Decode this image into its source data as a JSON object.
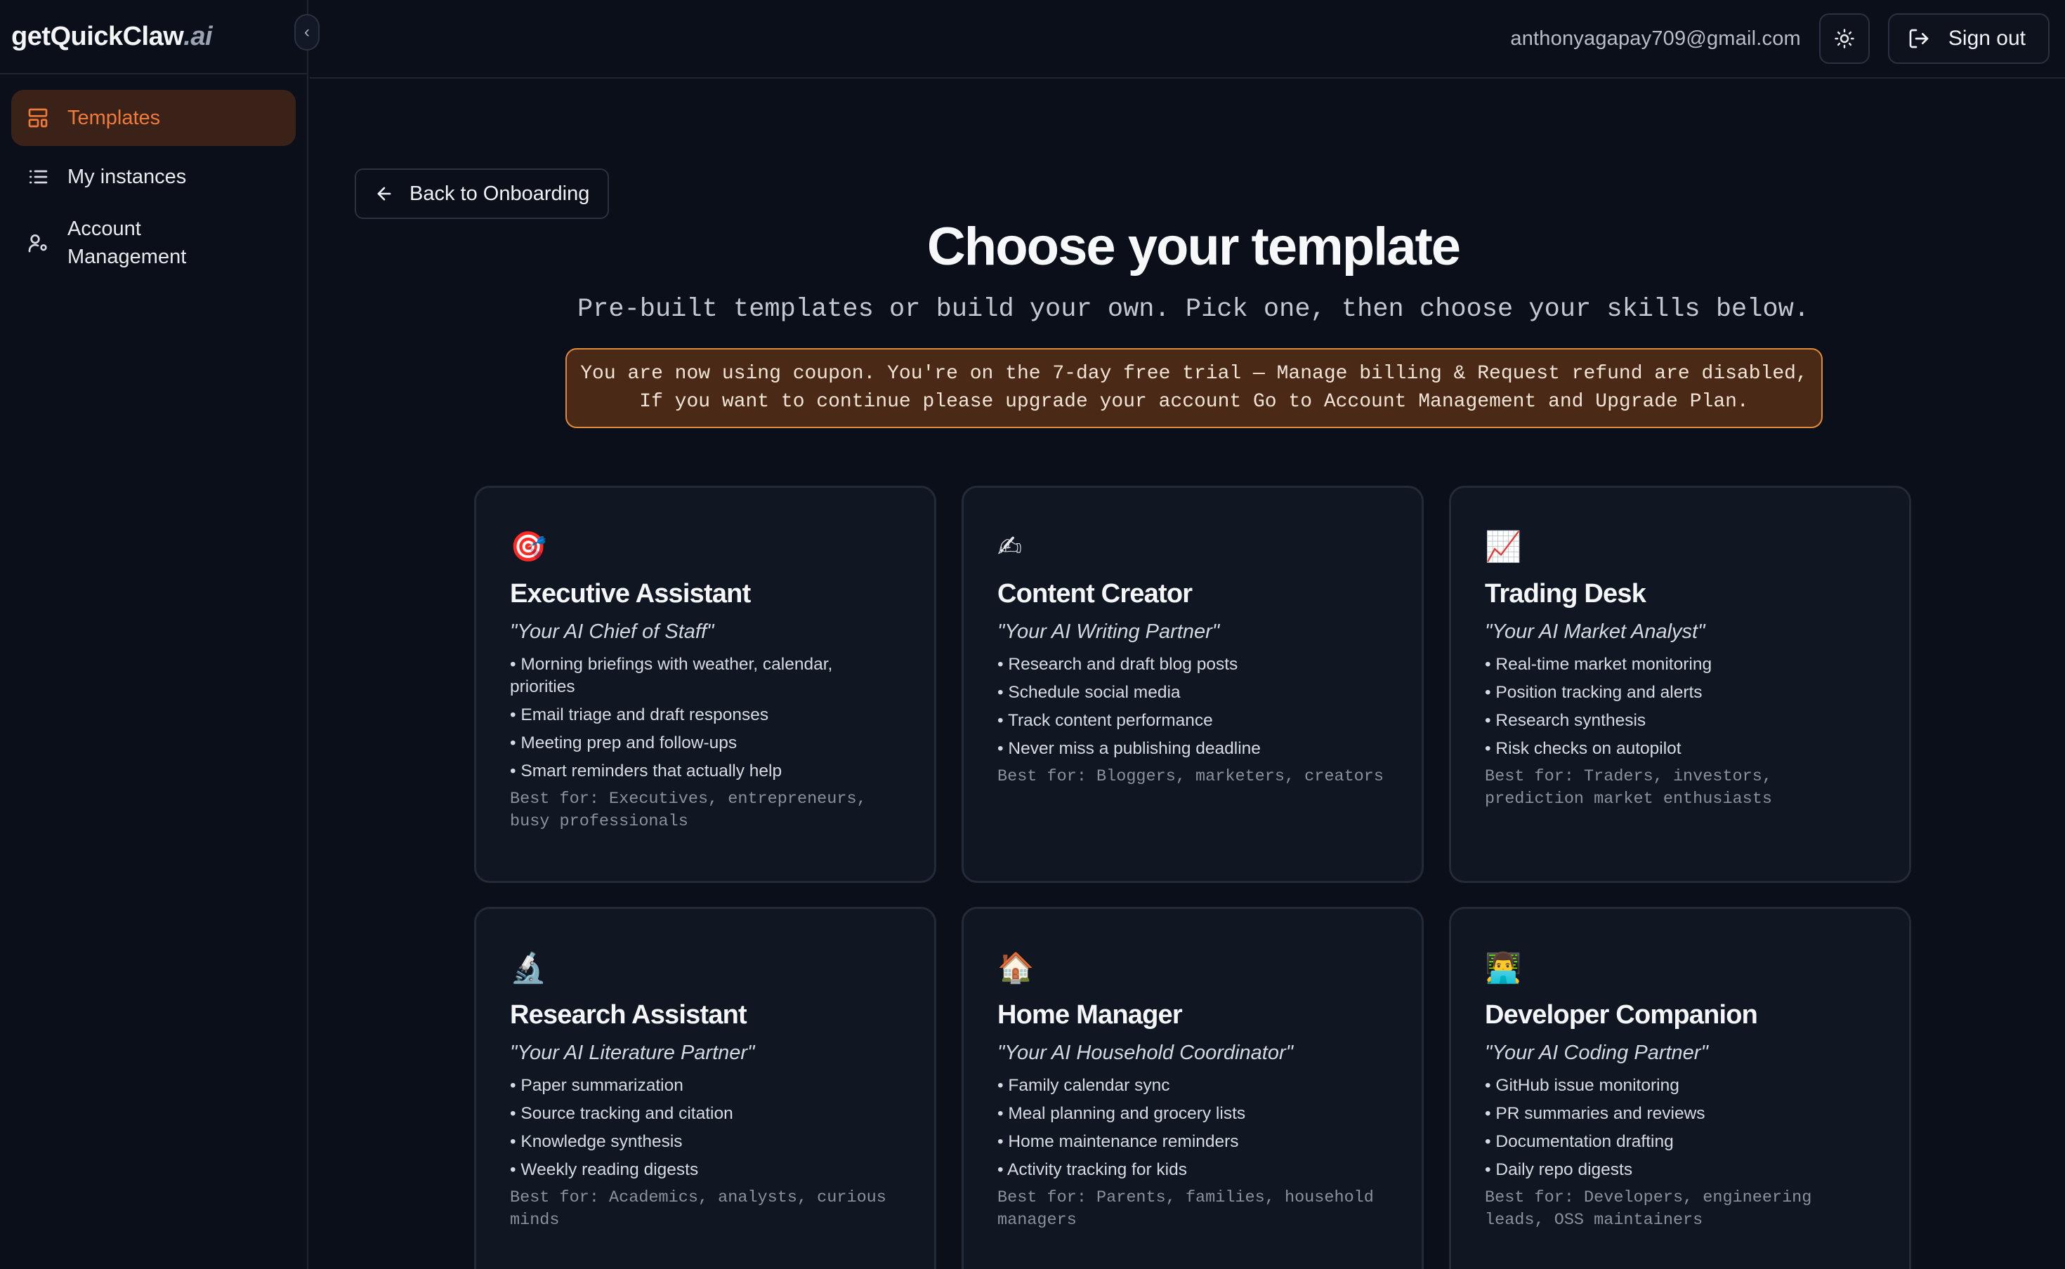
{
  "brand": {
    "name": "getQuickClaw",
    "suffix": ".ai"
  },
  "sidebar": {
    "collapse_glyph": "‹",
    "items": [
      {
        "label": "Templates",
        "icon": "layout-template-icon",
        "active": true
      },
      {
        "label": "My instances",
        "icon": "list-icon",
        "active": false
      },
      {
        "label": "Account Management",
        "icon": "user-cog-icon",
        "active": false
      }
    ]
  },
  "header": {
    "email": "anthonyagapay709@gmail.com",
    "theme_icon": "sun-icon",
    "signout_label": "Sign out"
  },
  "main": {
    "back_label": "Back to Onboarding",
    "title": "Choose your template",
    "subtitle": "Pre-built templates or build your own. Pick one, then choose your skills below.",
    "coupon_line1": "You are now using coupon. You're on the 7-day free trial — Manage billing & Request refund are disabled,",
    "coupon_line2": "If you want to continue please upgrade your account Go to Account Management and Upgrade Plan."
  },
  "templates": [
    {
      "emoji": "🎯",
      "title": "Executive Assistant",
      "tagline": "\"Your AI Chief of Staff\"",
      "bullets": [
        "• Morning briefings with weather, calendar, priorities",
        "• Email triage and draft responses",
        "• Meeting prep and follow-ups",
        "• Smart reminders that actually help"
      ],
      "best_for": "Best for: Executives, entrepreneurs, busy professionals"
    },
    {
      "emoji": "✍",
      "title": "Content Creator",
      "tagline": "\"Your AI Writing Partner\"",
      "bullets": [
        "• Research and draft blog posts",
        "• Schedule social media",
        "• Track content performance",
        "• Never miss a publishing deadline"
      ],
      "best_for": "Best for: Bloggers, marketers, creators"
    },
    {
      "emoji": "📈",
      "title": "Trading Desk",
      "tagline": "\"Your AI Market Analyst\"",
      "bullets": [
        "• Real-time market monitoring",
        "• Position tracking and alerts",
        "• Research synthesis",
        "• Risk checks on autopilot"
      ],
      "best_for": "Best for: Traders, investors, prediction market enthusiasts"
    },
    {
      "emoji": "🔬",
      "title": "Research Assistant",
      "tagline": "\"Your AI Literature Partner\"",
      "bullets": [
        "• Paper summarization",
        "• Source tracking and citation",
        "• Knowledge synthesis",
        "• Weekly reading digests"
      ],
      "best_for": "Best for: Academics, analysts, curious minds"
    },
    {
      "emoji": "🏠",
      "title": "Home Manager",
      "tagline": "\"Your AI Household Coordinator\"",
      "bullets": [
        "• Family calendar sync",
        "• Meal planning and grocery lists",
        "• Home maintenance reminders",
        "• Activity tracking for kids"
      ],
      "best_for": "Best for: Parents, families, household managers"
    },
    {
      "emoji": "👨‍💻",
      "title": "Developer Companion",
      "tagline": "\"Your AI Coding Partner\"",
      "bullets": [
        "• GitHub issue monitoring",
        "• PR summaries and reviews",
        "• Documentation drafting",
        "• Daily repo digests"
      ],
      "best_for": "Best for: Developers, engineering leads, OSS maintainers"
    }
  ]
}
